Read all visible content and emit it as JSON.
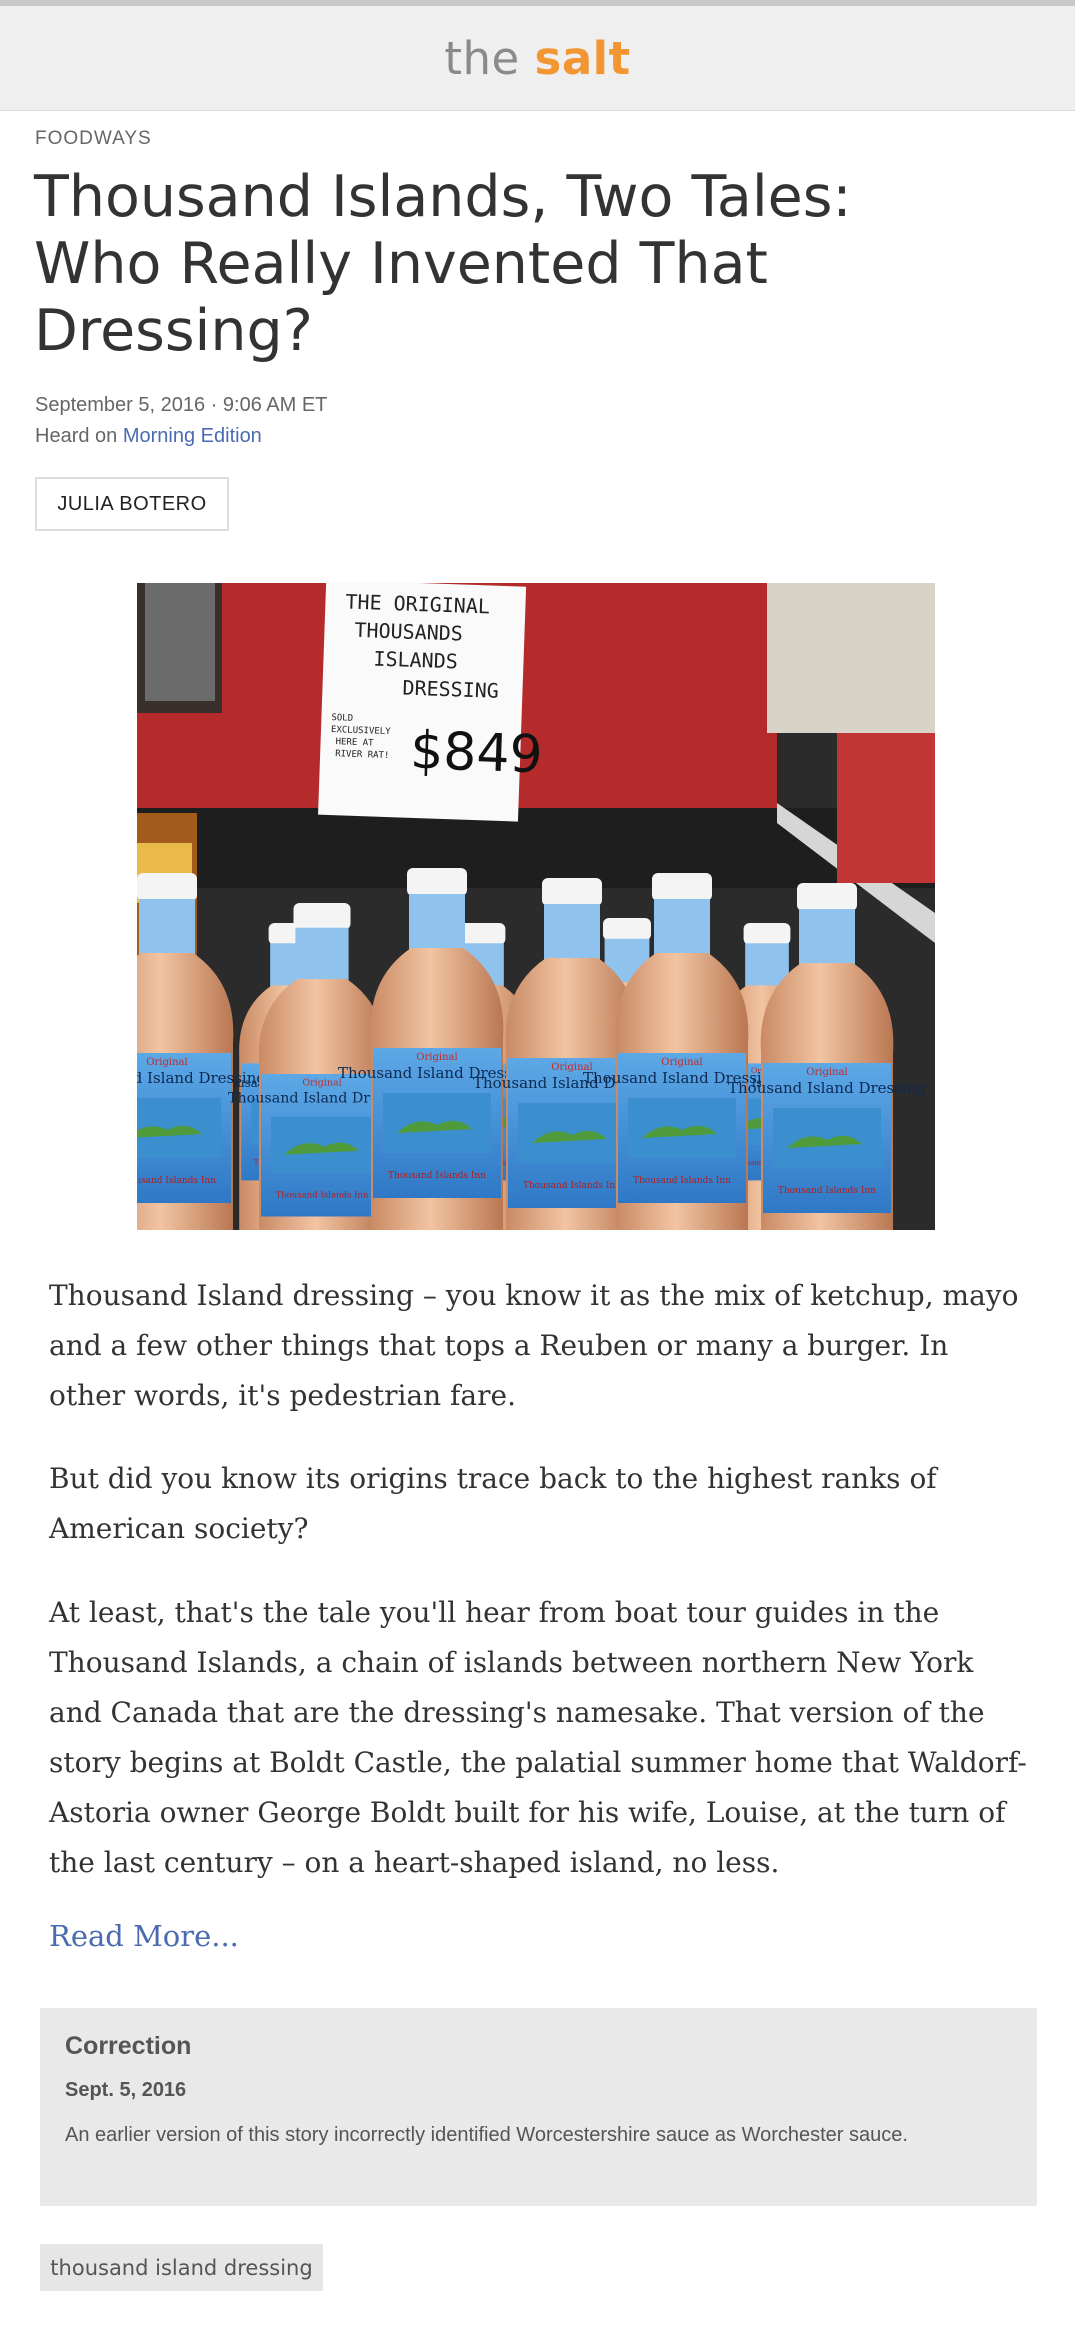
{
  "header": {
    "brand_the": "the",
    "brand_salt": "salt"
  },
  "article": {
    "section": "FOODWAYS",
    "headline": "Thousand Islands, Two Tales: Who Really Invented That Dressing?",
    "date": "September 5, 2016 · 9:06 AM ET",
    "heard_on_prefix": "Heard on ",
    "program": "Morning Edition",
    "author": "JULIA BOTERO",
    "photo": {
      "sign_lines": [
        "THE ORIGINAL",
        "THOUSANDS",
        "ISLANDS",
        "DRESSING"
      ],
      "sign_side": [
        "SOLD",
        "EXCLUSIVELY",
        "HERE AT",
        "RIVER RAT!"
      ],
      "sign_price": "$849",
      "label_text": "Thousand Island Dressing",
      "label_top": "Original",
      "label_bottom": "Thousand Islands Inn"
    },
    "paragraphs": [
      "Thousand Island dressing – you know it as the mix of ketchup, mayo and a few other things that tops a Reuben or many a burger. In other words, it's pedestrian fare.",
      "But did you know its origins trace back to the highest ranks of American society?",
      "At least, that's the tale you'll hear from boat tour guides in the Thousand Islands, a chain of islands between northern New York and Canada that are the dressing's namesake. That version of the story begins at Boldt Castle, the palatial summer home that Waldorf-Astoria owner George Boldt built for his wife, Louise, at the turn of the last century – on a heart-shaped island, no less."
    ],
    "read_more": "Read More..."
  },
  "correction": {
    "title": "Correction",
    "date": "Sept. 5, 2016",
    "text": "An earlier version of this story incorrectly identified Worcestershire sauce as Worchester sauce."
  },
  "tags": [
    "thousand island dressing"
  ]
}
